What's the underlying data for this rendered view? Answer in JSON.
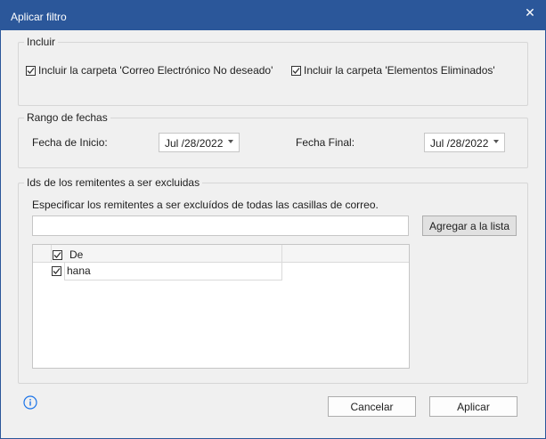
{
  "window": {
    "title": "Aplicar filtro",
    "close_glyph": "✕"
  },
  "incluir": {
    "legend": "Incluir",
    "junk_label": "Incluir la carpeta 'Correo Electrónico No deseado'",
    "junk_checked": true,
    "deleted_label": "Incluir la carpeta 'Elementos Eliminados'",
    "deleted_checked": true
  },
  "rango": {
    "legend": "Rango de fechas",
    "start_label": "Fecha de Inicio:",
    "start_value": "Jul /28/2022",
    "end_label": "Fecha Final:",
    "end_value": "Jul /28/2022"
  },
  "remitentes": {
    "legend": "Ids de los remitentes a ser excluidas",
    "description": "Especificar los remitentes a ser excluídos de todas las casillas de correo.",
    "input_value": "",
    "add_button": "Agregar a la lista",
    "list": {
      "header": "De",
      "header_checked": true,
      "rows": [
        {
          "label": "hana",
          "checked": true
        }
      ]
    }
  },
  "footer": {
    "info_icon": "info-icon",
    "cancel_button": "Cancelar",
    "apply_button": "Aplicar"
  },
  "colors": {
    "titlebar": "#2b579a",
    "info": "#1a73e8"
  }
}
